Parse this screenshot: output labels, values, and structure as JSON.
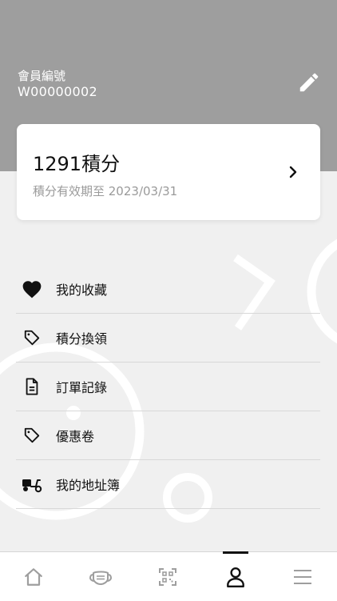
{
  "header": {
    "member_label": "會員編號",
    "member_id": "W00000002",
    "edit_icon": "pencil-icon"
  },
  "points_card": {
    "points": "1291積分",
    "expiry": "積分有效期至 2023/03/31",
    "arrow_icon": "chevron-right-icon"
  },
  "menu": {
    "items": [
      {
        "label": "我的收藏",
        "icon": "heart-icon"
      },
      {
        "label": "積分換領",
        "icon": "tag-icon"
      },
      {
        "label": "訂單記錄",
        "icon": "document-icon"
      },
      {
        "label": "優惠卷",
        "icon": "tag-icon"
      },
      {
        "label": "我的地址簿",
        "icon": "scooter-icon"
      }
    ]
  },
  "tabbar": {
    "tabs": [
      {
        "icon": "home-icon",
        "active": false
      },
      {
        "icon": "mask-icon",
        "active": false
      },
      {
        "icon": "qr-code-icon",
        "active": false
      },
      {
        "icon": "user-icon",
        "active": true
      },
      {
        "icon": "menu-icon",
        "active": false
      }
    ]
  },
  "colors": {
    "header_bg": "#9e9e9e",
    "page_bg": "#f0f0f0",
    "text": "#111111",
    "muted": "#9a9a9a",
    "active_tab": "#111111",
    "inactive_tab": "#9e9e9e"
  }
}
